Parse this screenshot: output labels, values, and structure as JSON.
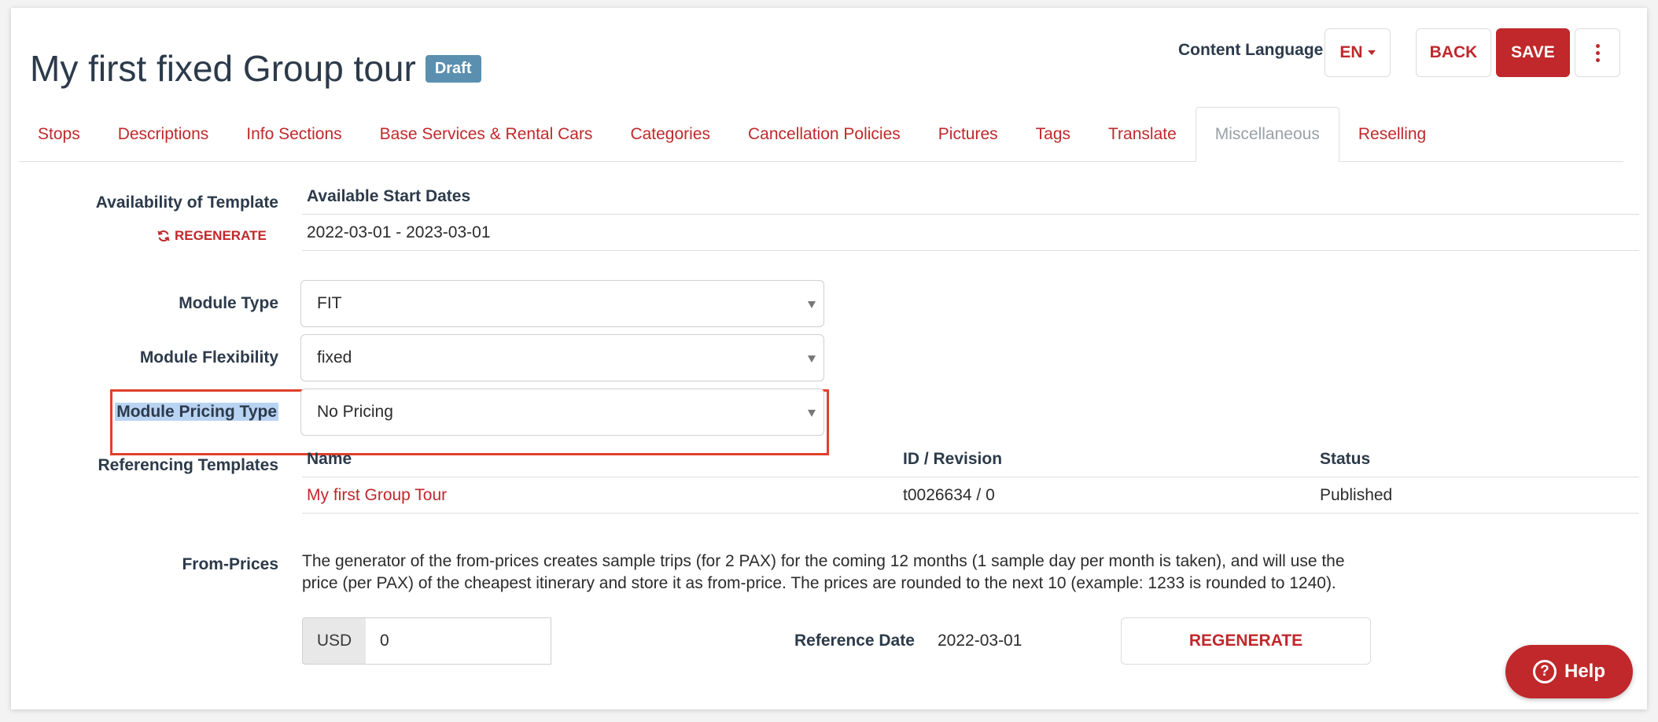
{
  "header": {
    "title": "My first fixed Group tour",
    "status_badge": "Draft",
    "content_language_label": "Content Language",
    "language": "EN",
    "back_label": "BACK",
    "save_label": "SAVE"
  },
  "tabs": [
    {
      "label": "Stops"
    },
    {
      "label": "Descriptions"
    },
    {
      "label": "Info Sections"
    },
    {
      "label": "Base Services & Rental Cars"
    },
    {
      "label": "Categories"
    },
    {
      "label": "Cancellation Policies"
    },
    {
      "label": "Pictures"
    },
    {
      "label": "Tags"
    },
    {
      "label": "Translate"
    },
    {
      "label": "Miscellaneous",
      "active": true
    },
    {
      "label": "Reselling"
    }
  ],
  "availability": {
    "label": "Availability of Template",
    "regenerate_label": "REGENERATE",
    "column_header": "Available Start Dates",
    "value": "2022-03-01 - 2023-03-01"
  },
  "module_type": {
    "label": "Module Type",
    "value": "FIT"
  },
  "module_flexibility": {
    "label": "Module Flexibility",
    "value": "fixed"
  },
  "module_pricing_type": {
    "label": "Module Pricing Type",
    "value": "No Pricing"
  },
  "referencing_templates": {
    "label": "Referencing Templates",
    "columns": [
      "Name",
      "ID / Revision",
      "Status"
    ],
    "rows": [
      {
        "name": "My first Group Tour",
        "id_revision": "t0026634 / 0",
        "status": "Published"
      }
    ]
  },
  "from_prices": {
    "label": "From-Prices",
    "description": "The generator of the from-prices creates sample trips (for 2 PAX) for the coming 12 months (1 sample day per month is taken), and will use the price (per PAX) of the cheapest itinerary and store it as from-price. The prices are rounded to the next 10 (example: 1233 is rounded to 1240).",
    "currency": "USD",
    "amount": "0",
    "reference_date_label": "Reference Date",
    "reference_date": "2022-03-01",
    "regenerate_label": "REGENERATE"
  },
  "help": {
    "label": "Help"
  },
  "colors": {
    "accent": "#c0282b",
    "badge": "#5b8fb0",
    "highlight": "#e0402a"
  }
}
